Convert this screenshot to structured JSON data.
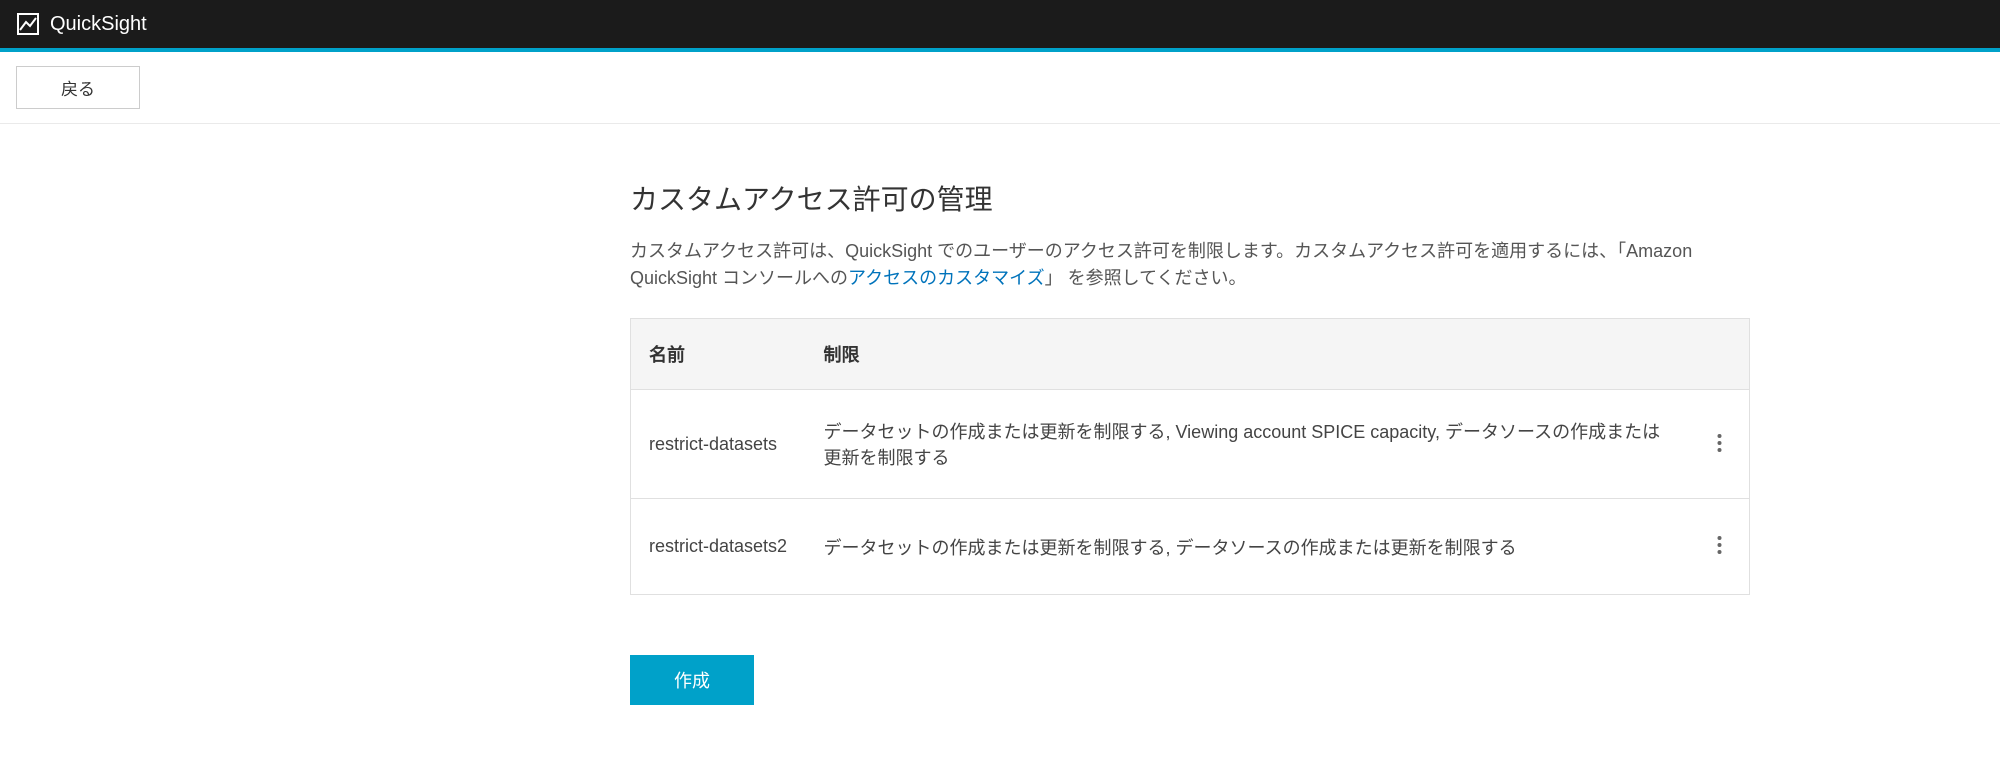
{
  "app": {
    "name": "QuickSight"
  },
  "toolbar": {
    "back_label": "戻る"
  },
  "page": {
    "title": "カスタムアクセス許可の管理",
    "description_prefix": "カスタムアクセス許可は、QuickSight でのユーザーのアクセス許可を制限します。カスタムアクセス許可を適用するには、「Amazon QuickSight コンソールへの",
    "description_link": "アクセスのカスタマイズ",
    "description_suffix": "」 を参照してください。"
  },
  "table": {
    "headers": {
      "name": "名前",
      "restrict": "制限"
    },
    "rows": [
      {
        "name": "restrict-datasets",
        "restrict": "データセットの作成または更新を制限する, Viewing account SPICE capacity, データソースの作成または更新を制限する"
      },
      {
        "name": "restrict-datasets2",
        "restrict": "データセットの作成または更新を制限する, データソースの作成または更新を制限する"
      }
    ]
  },
  "actions": {
    "create_label": "作成"
  }
}
